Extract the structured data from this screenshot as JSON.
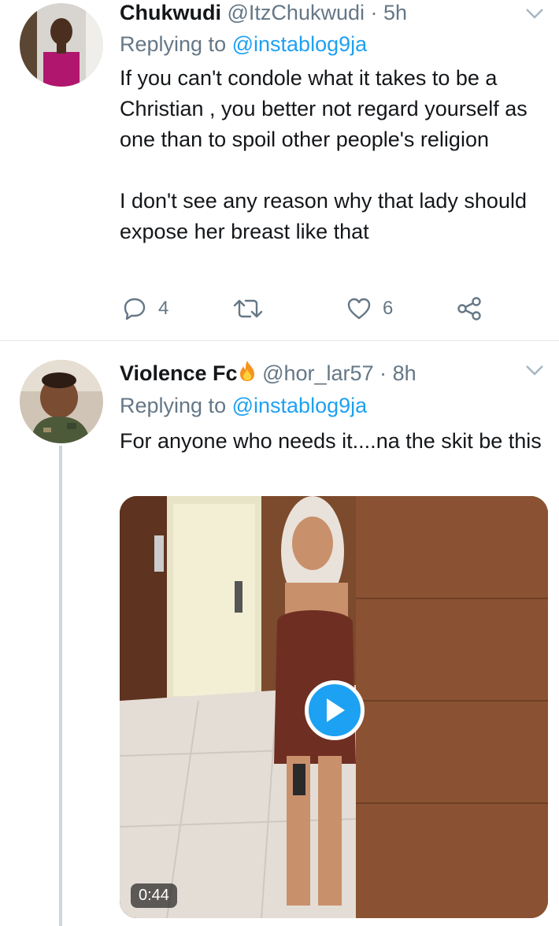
{
  "tweets": [
    {
      "name": "Chukwudi",
      "handle": "@ItzChukwudi",
      "time": "· 5h",
      "replying_prefix": "Replying to",
      "replying_to": "@instablog9ja",
      "paragraphs": [
        "If you can't condole what it takes to be a Christian , you better not regard yourself as one than to spoil other people's religion",
        "I don't see any reason why that lady should expose her breast like that"
      ],
      "reply_count": "4",
      "retweet_count": "",
      "like_count": "6"
    },
    {
      "name": "Violence Fc",
      "name_emoji": "fire-emoji-icon",
      "handle": "@hor_lar57",
      "time": "· 8h",
      "replying_prefix": "Replying to",
      "replying_to": "@instablog9ja",
      "text": "For anyone who needs it....na the skit be this",
      "video_duration": "0:44"
    }
  ],
  "colors": {
    "accent": "#1da1f2",
    "muted": "#657786",
    "text": "#14171a",
    "divider": "#e1e8ed",
    "thread_line": "#ccd6dd"
  }
}
